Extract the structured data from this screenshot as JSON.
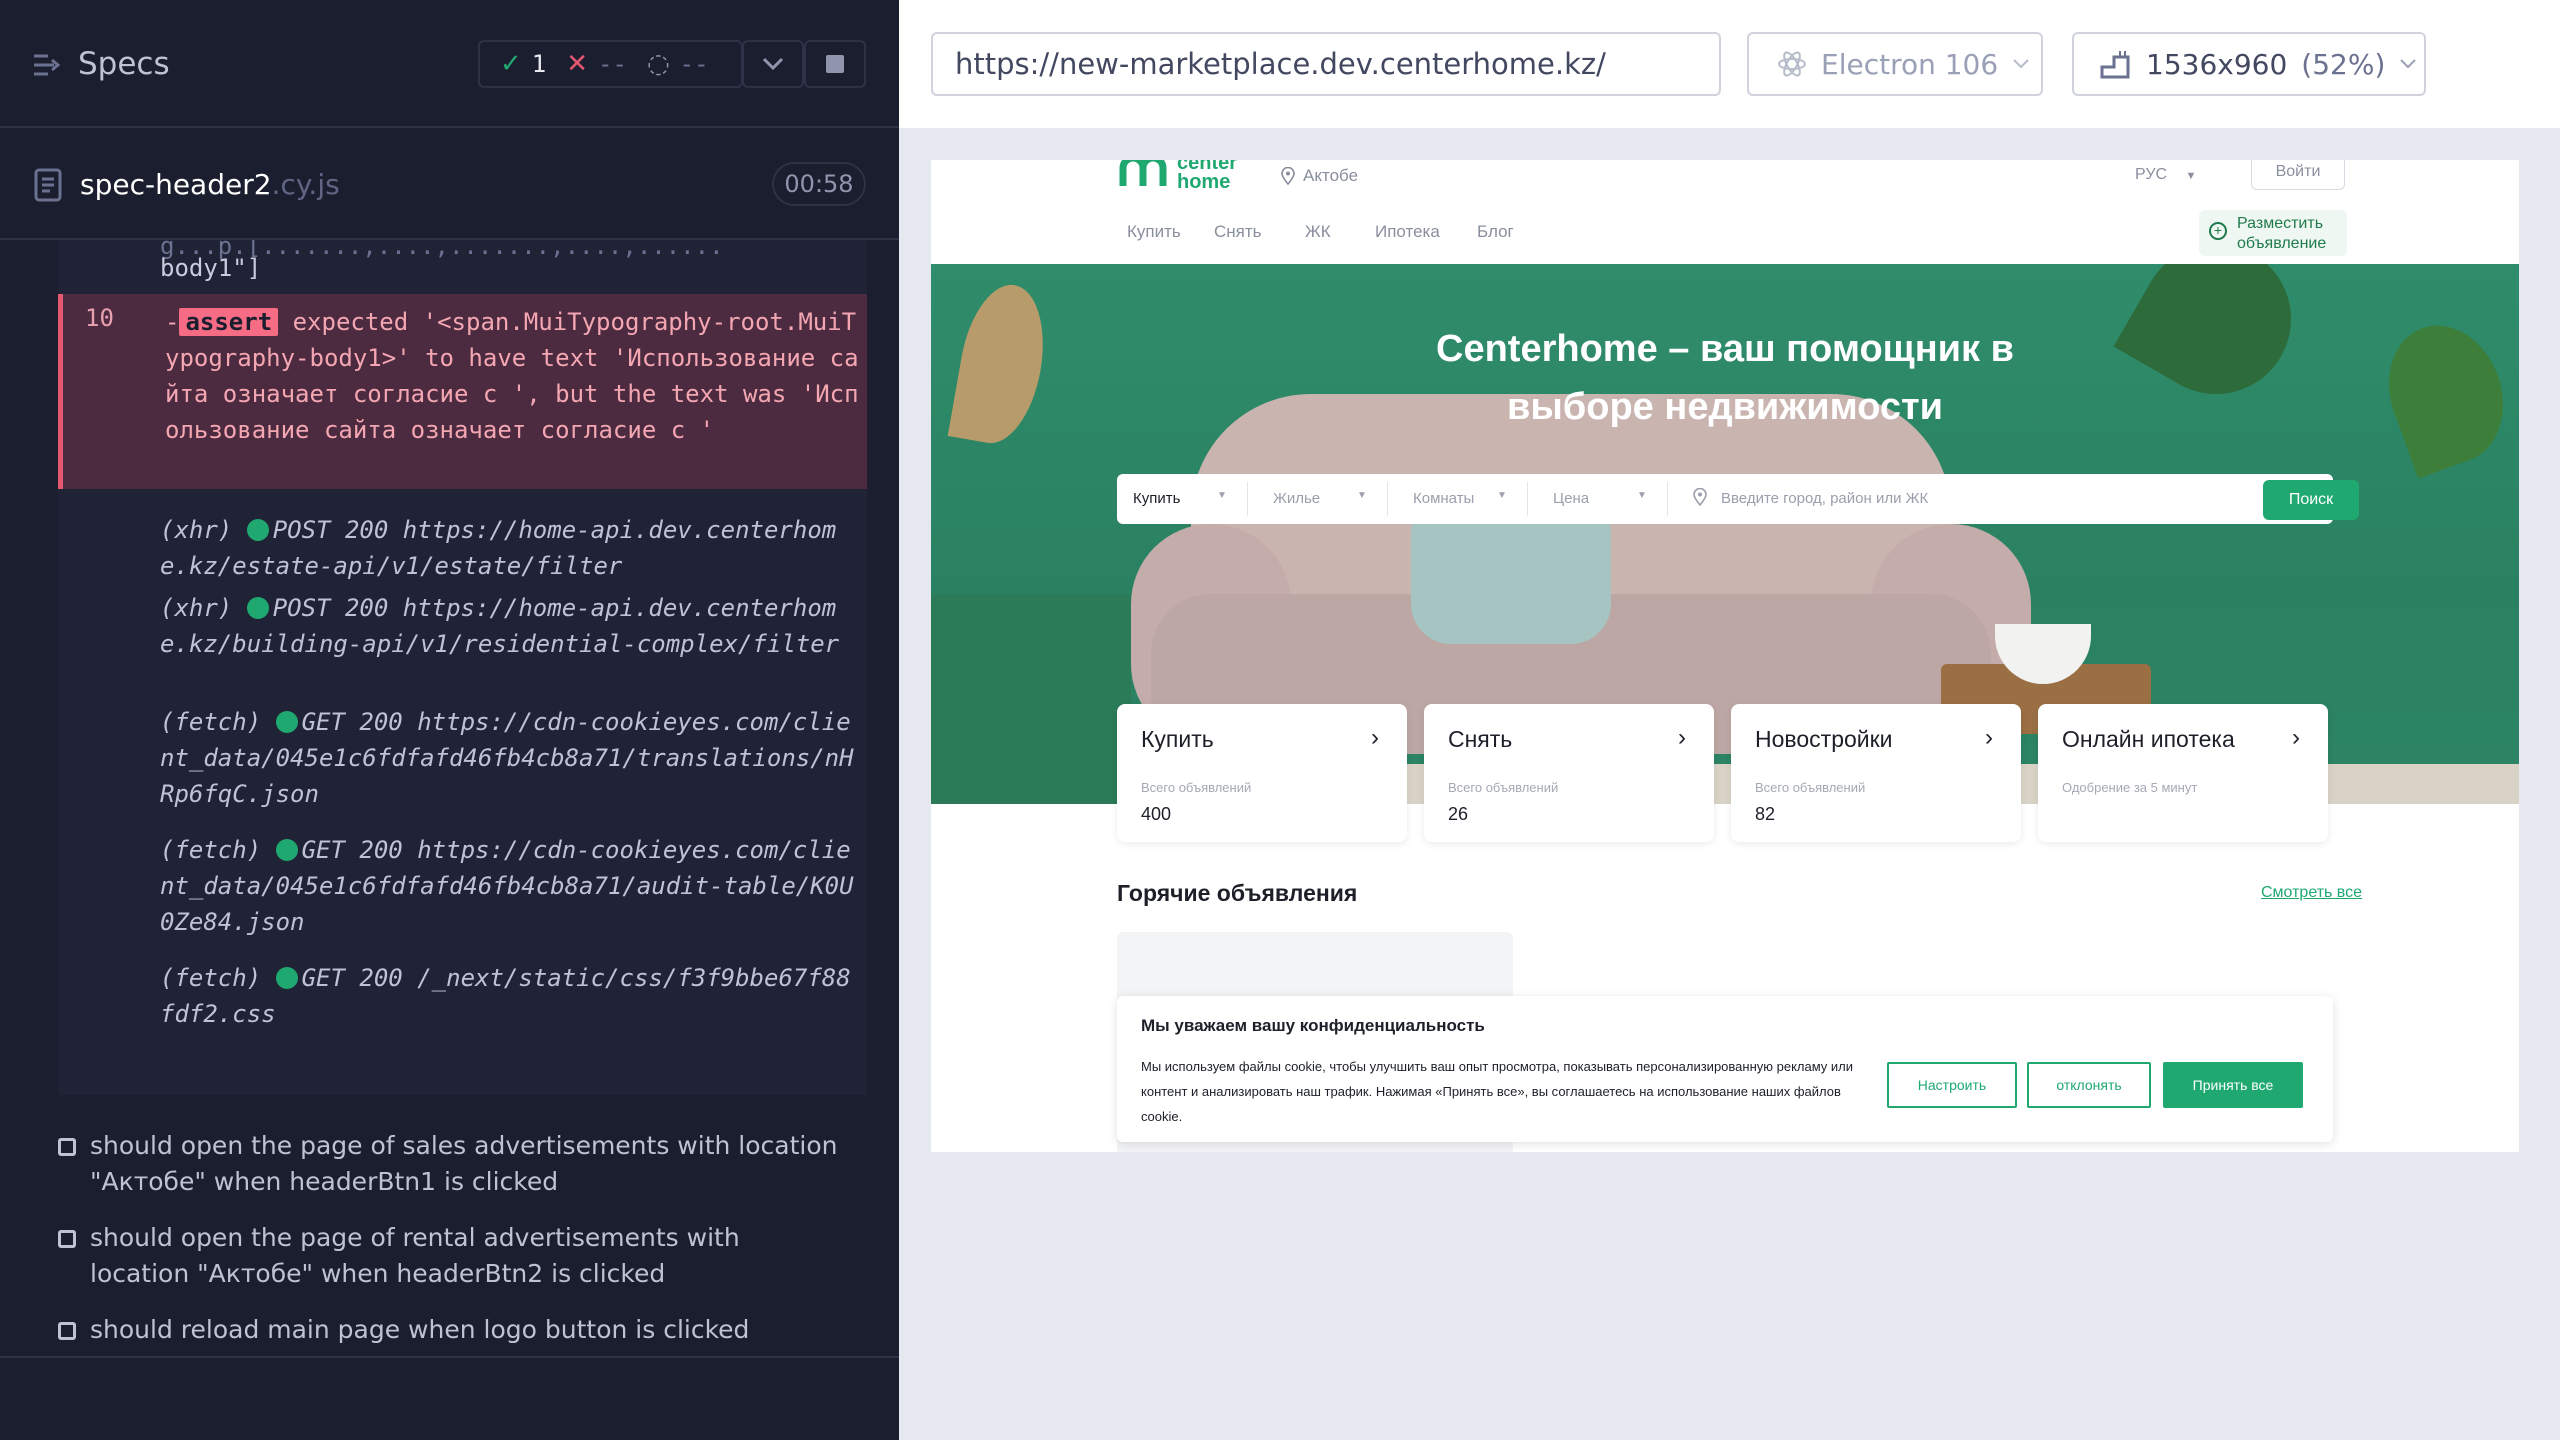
{
  "runner": {
    "title": "Specs",
    "stats": {
      "passed": "1",
      "failed": "--",
      "pending": "--"
    },
    "spec_file": {
      "name": "spec-header2",
      "ext": ".cy.js",
      "time": "00:58"
    },
    "cut_line": "body1\"]",
    "error": {
      "num": "10",
      "dash": "-",
      "keyword": "assert",
      "text": " expected '<span.MuiTypography-root.MuiTypography-body1>' to have text 'Использование сайта означает согласие с   ', but the text was 'Использование сайта означает согласие с   '"
    },
    "logs": [
      {
        "type": "(xhr)",
        "method": "POST 200",
        "url": "https://home-api.dev.centerhome.kz/estate-api/v1/estate/filter"
      },
      {
        "type": "(xhr)",
        "method": "POST 200",
        "url": "https://home-api.dev.centerhome.kz/building-api/v1/residential-complex/filter"
      },
      {
        "type": "(fetch)",
        "method": "GET 200",
        "url": "https://cdn-cookieyes.com/client_data/045e1c6fdfafd46fb4cb8a71/translations/nHRp6fqC.json"
      },
      {
        "type": "(fetch)",
        "method": "GET 200",
        "url": "https://cdn-cookieyes.com/client_data/045e1c6fdfafd46fb4cb8a71/audit-table/K0U0Ze84.json"
      },
      {
        "type": "(fetch)",
        "method": "GET 200",
        "url": "/_next/static/css/f3f9bbe67f88fdf2.css"
      }
    ],
    "tests": [
      "should open the page of sales advertisements with location \"Актобе\" when headerBtn1 is clicked",
      "should open the page of rental advertisements with location \"Актобе\" when headerBtn2 is clicked",
      "should reload main page when logo button is clicked"
    ]
  },
  "aut": {
    "url": "https://new-marketplace.dev.centerhome.kz/",
    "browser": "Electron 106",
    "viewport": "1536x960",
    "zoom": "(52%)"
  },
  "site": {
    "logo_line1": "center",
    "logo_line2": "home",
    "city": "Актобе",
    "lang": "РУС",
    "login": "Войти",
    "nav": [
      "Купить",
      "Снять",
      "ЖК",
      "Ипотека",
      "Блог"
    ],
    "post_ad": "Разместить объявление",
    "hero_title_1": "Centerhome – ваш помощник в",
    "hero_title_2": "выборе недвижимости",
    "search": {
      "deal": "Купить",
      "type": "Жилье",
      "rooms": "Комнаты",
      "price": "Цена",
      "placeholder": "Введите  город, район или ЖК",
      "button": "Поиск"
    },
    "cards": [
      {
        "title": "Купить",
        "sub": "Всего объявлений",
        "num": "400"
      },
      {
        "title": "Снять",
        "sub": "Всего объявлений",
        "num": "26"
      },
      {
        "title": "Новостройки",
        "sub": "Всего объявлений",
        "num": "82"
      },
      {
        "title": "Онлайн ипотека",
        "sub": "Одобрение за 5 минут",
        "num": ""
      }
    ],
    "hot_title": "Горячие объявления",
    "see_all": "Смотреть все",
    "cookie": {
      "title": "Мы уважаем вашу конфиденциальность",
      "body": "Мы используем файлы cookie, чтобы улучшить ваш опыт просмотра, показывать персонализированную рекламу или контент и анализировать наш трафик. Нажимая «Принять все», вы соглашаетесь на использование наших файлов cookie.",
      "btn_customize": "Настроить",
      "btn_reject": "отклонять",
      "btn_accept": "Принять все"
    }
  },
  "colors": {
    "green": "#1fa971",
    "error_bg": "#4c2a3f",
    "runner_bg": "#1b1e2e"
  }
}
